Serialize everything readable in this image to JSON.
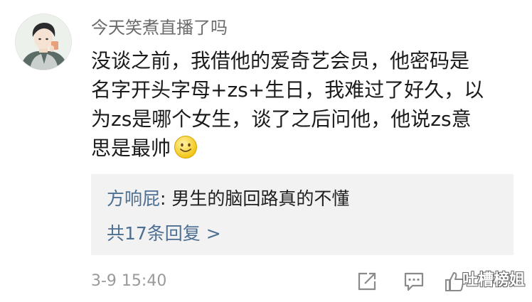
{
  "comment": {
    "username": "今天笑煮直播了吗",
    "text_lines": [
      "没谈之前，我借他的爱奇艺会员，他密码是",
      "名字开头字母+zs+生日，我难过了好久，以",
      "为zs是哪个女生，谈了之后问他，他说zs意",
      "思是最帅"
    ],
    "emoji": "smiley-emoji",
    "timestamp": "3-9 15:40"
  },
  "replies": {
    "first_author": "方响屁",
    "first_separator": ": ",
    "first_text": "男生的脑回路真的不懂",
    "more_label": "共17条回复 >"
  },
  "actions": {
    "icons": [
      "share-icon",
      "reply-icon",
      "like-icon"
    ]
  },
  "watermark": "吐槽榜姐",
  "colors": {
    "link_blue": "#4d6f92",
    "text": "#1b1b1b",
    "muted": "#9a9a9a",
    "reply_bg": "#f2f2f2"
  }
}
